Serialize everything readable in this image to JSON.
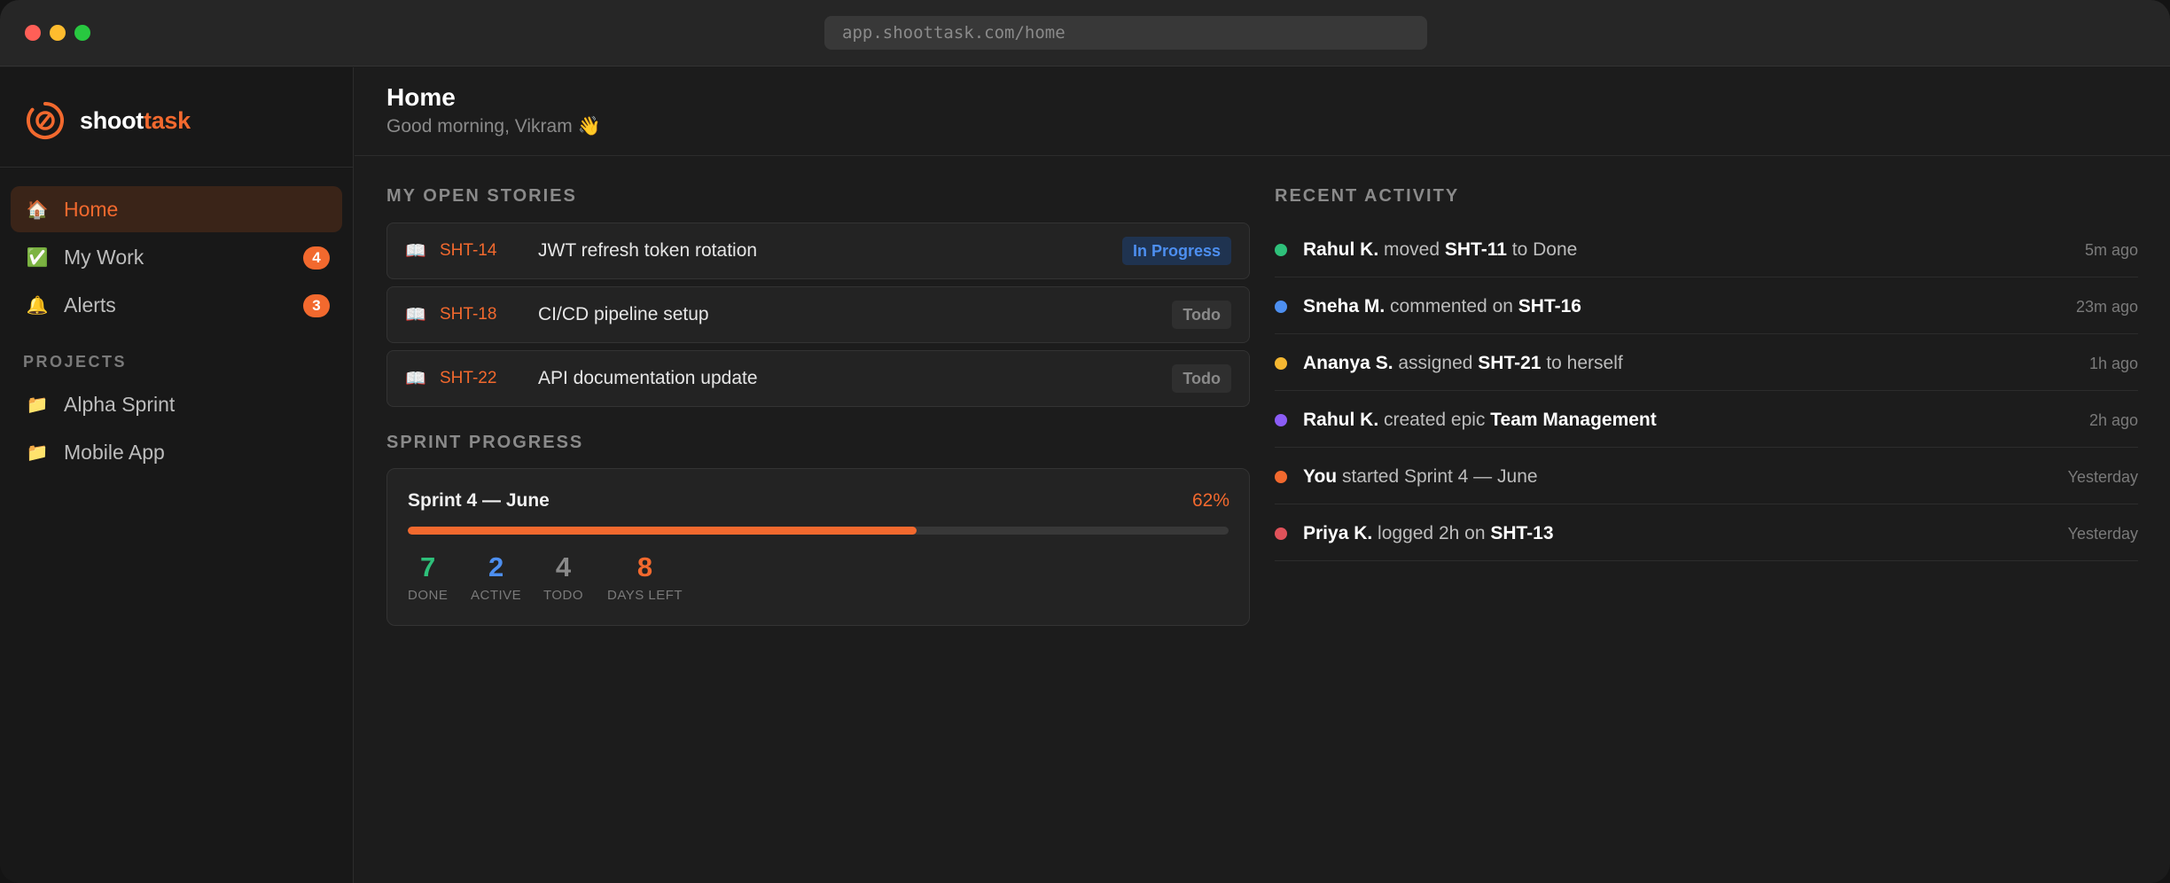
{
  "browser": {
    "url": "app.shoottask.com/home"
  },
  "brand": {
    "name_main": "shoot",
    "name_accent": "task",
    "accent_color": "#f2692e"
  },
  "sidebar": {
    "nav": [
      {
        "icon": "🏠",
        "label": "Home",
        "active": true
      },
      {
        "icon": "✅",
        "label": "My Work",
        "badge": "4"
      },
      {
        "icon": "🔔",
        "label": "Alerts",
        "badge": "3"
      }
    ],
    "projects_label": "PROJECTS",
    "projects": [
      {
        "icon": "📁",
        "label": "Alpha Sprint"
      },
      {
        "icon": "📁",
        "label": "Mobile App"
      }
    ]
  },
  "header": {
    "title": "Home",
    "subtitle": "Good morning, Vikram 👋"
  },
  "stories": {
    "heading": "MY OPEN STORIES",
    "items": [
      {
        "icon": "📖",
        "key": "SHT-14",
        "title": "JWT refresh token rotation",
        "status": "In Progress"
      },
      {
        "icon": "📖",
        "key": "SHT-18",
        "title": "CI/CD pipeline setup",
        "status": "Todo"
      },
      {
        "icon": "📖",
        "key": "SHT-22",
        "title": "API documentation update",
        "status": "Todo"
      }
    ]
  },
  "sprint": {
    "heading": "SPRINT PROGRESS",
    "name": "Sprint 4 — June",
    "percent_label": "62%",
    "progress": 0.62,
    "stats": [
      {
        "value": "7",
        "label": "DONE",
        "color": "#2ec07a"
      },
      {
        "value": "2",
        "label": "ACTIVE",
        "color": "#4d8ff0"
      },
      {
        "value": "4",
        "label": "TODO",
        "color": "#8a8a8a"
      },
      {
        "value": "8",
        "label": "DAYS LEFT",
        "color": "#f2692e"
      }
    ]
  },
  "activity": {
    "heading": "RECENT ACTIVITY",
    "items": [
      {
        "dot_color": "#2ec07a",
        "actor": "Rahul K.",
        "verb": " moved ",
        "object": "SHT-11",
        "tail": " to Done",
        "time": "5m ago"
      },
      {
        "dot_color": "#4d8ff0",
        "actor": "Sneha M.",
        "verb": " commented on ",
        "object": "SHT-16",
        "tail": "",
        "time": "23m ago"
      },
      {
        "dot_color": "#f5b731",
        "actor": "Ananya S.",
        "verb": " assigned ",
        "object": "SHT-21",
        "tail": " to herself",
        "time": "1h ago"
      },
      {
        "dot_color": "#8b5cf6",
        "actor": "Rahul K.",
        "verb": " created epic ",
        "object": "Team Management",
        "tail": "",
        "time": "2h ago"
      },
      {
        "dot_color": "#f2692e",
        "actor": "You",
        "verb": " started Sprint 4 — June",
        "object": "",
        "tail": "",
        "time": "Yesterday"
      },
      {
        "dot_color": "#e0525a",
        "actor": "Priya K.",
        "verb": " logged 2h on ",
        "object": "SHT-13",
        "tail": "",
        "time": "Yesterday"
      }
    ]
  }
}
